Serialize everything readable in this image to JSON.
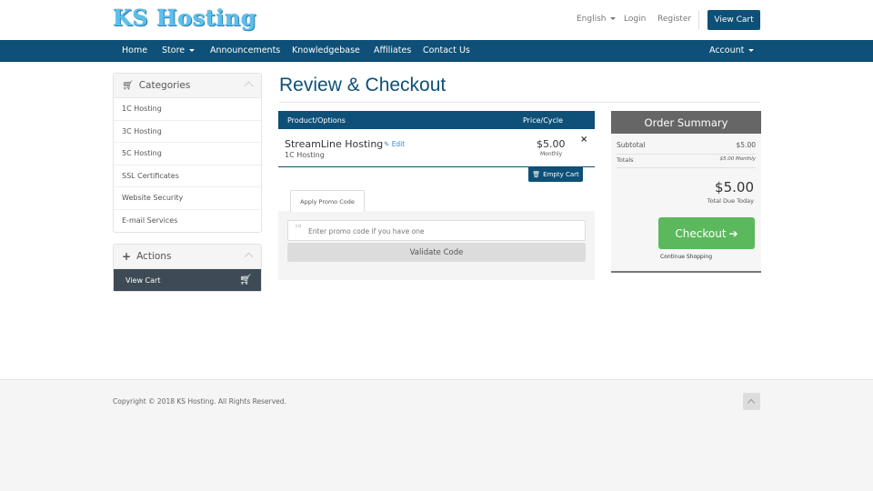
{
  "brand": {
    "logo_text": "KS Hosting"
  },
  "top_links": {
    "language": "English",
    "login": "Login",
    "register": "Register",
    "view_cart": "View Cart"
  },
  "navbar": {
    "items": [
      "Home",
      "Store",
      "Announcements",
      "Knowledgebase",
      "Affiliates",
      "Contact Us"
    ],
    "account": "Account"
  },
  "sidebar": {
    "categories_title": "Categories",
    "categories": [
      "1C Hosting",
      "3C Hosting",
      "5C Hosting",
      "SSL Certificates",
      "Website Security",
      "E-mail Services"
    ],
    "actions_title": "Actions",
    "actions": [
      "View Cart"
    ]
  },
  "main": {
    "title": "Review & Checkout",
    "table_headers": {
      "product": "Product/Options",
      "price": "Price/Cycle"
    },
    "cart_item": {
      "name": "StreamLine Hosting",
      "edit": "Edit",
      "group": "1C Hosting",
      "price": "$5.00",
      "cycle": "Monthly",
      "remove": "×"
    },
    "empty_cart": "Empty Cart",
    "promo": {
      "tab": "Apply Promo Code",
      "placeholder": "Enter promo code if you have one",
      "validate": "Validate Code"
    }
  },
  "summary": {
    "title": "Order Summary",
    "subtotal_label": "Subtotal",
    "subtotal_value": "$5.00",
    "totals_label": "Totals",
    "totals_value": "$5.00 Monthly",
    "total_due": "$5.00",
    "total_due_label": "Total Due Today",
    "checkout": "Checkout",
    "continue": "Continue Shopping"
  },
  "footer": {
    "copyright": "Copyright © 2018 KS Hosting. All Rights Reserved."
  },
  "colors": {
    "primary": "#0e5077",
    "success": "#5cb85c",
    "summary_header": "#666666",
    "sidebar_active": "#3e4a55"
  }
}
